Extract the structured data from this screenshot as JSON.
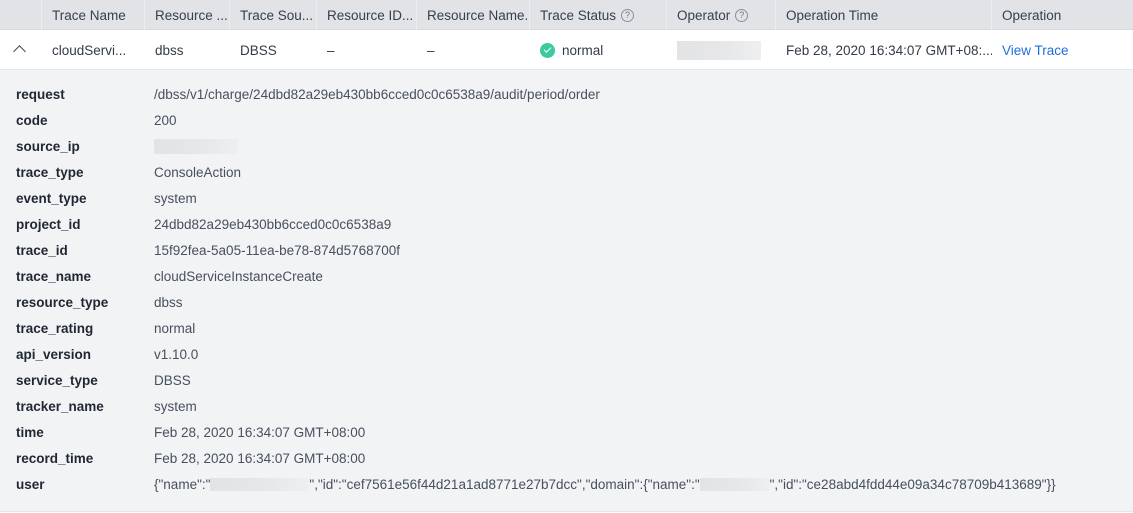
{
  "table": {
    "columns": [
      {
        "key": "expander",
        "label": "",
        "icon": "",
        "class": "c-expander"
      },
      {
        "key": "trace_name",
        "label": "Trace Name",
        "icon": "",
        "class": "c-trace-name"
      },
      {
        "key": "resource_type",
        "label": "Resource ...",
        "icon": "",
        "class": "c-resource-type"
      },
      {
        "key": "trace_source",
        "label": "Trace Sou...",
        "icon": "",
        "class": "c-trace-source"
      },
      {
        "key": "resource_id",
        "label": "Resource ID...",
        "icon": "",
        "class": "c-resource-id"
      },
      {
        "key": "resource_name",
        "label": "Resource Name...",
        "icon": "",
        "class": "c-resource-name"
      },
      {
        "key": "trace_status",
        "label": "Trace Status",
        "icon": "help-icon",
        "class": "c-trace-status"
      },
      {
        "key": "operator",
        "label": "Operator",
        "icon": "help-icon",
        "class": "c-operator"
      },
      {
        "key": "operation_time",
        "label": "Operation Time",
        "icon": "",
        "class": "c-operation-time"
      },
      {
        "key": "operation",
        "label": "Operation",
        "icon": "",
        "class": "c-operation"
      }
    ],
    "headers": {
      "trace_name": "Trace Name",
      "resource_type": "Resource ...",
      "trace_source": "Trace Sou...",
      "resource_id": "Resource ID...",
      "resource_name": "Resource Name...",
      "trace_status": "Trace Status",
      "operator": "Operator",
      "operation_time": "Operation Time",
      "operation": "Operation",
      "help_glyph": "?"
    },
    "row": {
      "expanded": true,
      "expander_icon": "chevron-up-icon",
      "trace_name": "cloudServi...",
      "resource_type": "dbss",
      "trace_source": "DBSS",
      "resource_id": "–",
      "resource_name": "–",
      "trace_status": "normal",
      "operator": "",
      "operation_time": "Feb 28, 2020 16:34:07 GMT+08:...",
      "operation": "View Trace"
    }
  },
  "detail": {
    "rows": [
      {
        "key": "request",
        "value": "/dbss/v1/charge/24dbd82a29eb430bb6cced0c0c6538a9/audit/period/order"
      },
      {
        "key": "code",
        "value": "200"
      },
      {
        "key": "source_ip",
        "value": ""
      },
      {
        "key": "trace_type",
        "value": "ConsoleAction"
      },
      {
        "key": "event_type",
        "value": "system"
      },
      {
        "key": "project_id",
        "value": "24dbd82a29eb430bb6cced0c0c6538a9"
      },
      {
        "key": "trace_id",
        "value": "15f92fea-5a05-11ea-be78-874d5768700f"
      },
      {
        "key": "trace_name",
        "value": "cloudServiceInstanceCreate"
      },
      {
        "key": "resource_type",
        "value": "dbss"
      },
      {
        "key": "trace_rating",
        "value": "normal"
      },
      {
        "key": "api_version",
        "value": "v1.10.0"
      },
      {
        "key": "service_type",
        "value": "DBSS"
      },
      {
        "key": "tracker_name",
        "value": "system"
      },
      {
        "key": "time",
        "value": "Feb 28, 2020 16:34:07 GMT+08:00"
      },
      {
        "key": "record_time",
        "value": "Feb 28, 2020 16:34:07 GMT+08:00"
      },
      {
        "key": "user",
        "value": ""
      }
    ],
    "user_value": {
      "part1": "{\"name\":\"",
      "part2": "\",\"id\":\"cef7561e56f44d21a1ad8771e27b7dcc\",\"domain\":{\"name\":\"",
      "part3": "\",\"id\":\"ce28abd4fdd44e09a34c78709b413689\"}}"
    }
  },
  "colors": {
    "header_bg": "#e1e3e6",
    "panel_bg": "#f2f3f5",
    "link": "#1e6fd9",
    "status_normal": "#3bc9a0",
    "text": "#333b47"
  }
}
